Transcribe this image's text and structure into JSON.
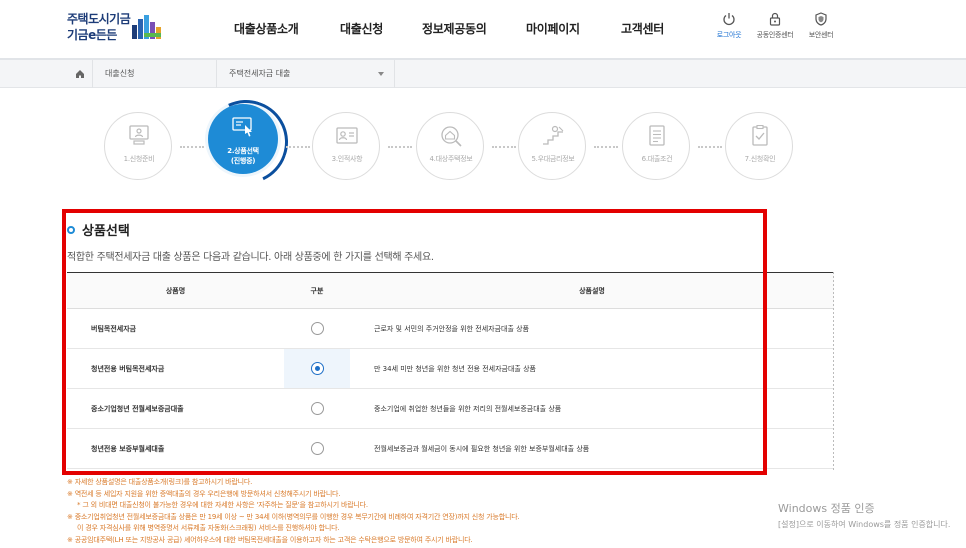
{
  "logo": {
    "line1": "주택도시기금",
    "line2": "기금e든든"
  },
  "nav": [
    "대출상품소개",
    "대출신청",
    "정보제공동의",
    "마이페이지",
    "고객센터"
  ],
  "utility": [
    {
      "label": "로그아웃",
      "icon": "power-icon",
      "active": true
    },
    {
      "label": "공동인증센터",
      "icon": "lock-icon",
      "active": false
    },
    {
      "label": "보안센터",
      "icon": "shield-icon",
      "active": false
    }
  ],
  "breadcrumb": {
    "home_icon": "home-icon",
    "level1": "대출신청",
    "level2": "주택전세자금 대출"
  },
  "steps": [
    {
      "label": "1.신청준비"
    },
    {
      "label_line1": "2.상품선택",
      "label_line2": "(진행중)"
    },
    {
      "label": "3.인적사항"
    },
    {
      "label": "4.대상주택정보"
    },
    {
      "label": "5.우대금리정보"
    },
    {
      "label": "6.대출조건"
    },
    {
      "label": "7.신청확인"
    }
  ],
  "section": {
    "title": "상품선택",
    "description": "적합한 주택전세자금 대출 상품은 다음과 같습니다. 아래 상품중에 한 가지를 선택해 주세요."
  },
  "table": {
    "headers": [
      "상품명",
      "구분",
      "상품설명"
    ],
    "rows": [
      {
        "name": "버팀목전세자금",
        "desc": "근로자 및 서민의 주거안정을 위한 전세자금대출 상품",
        "selected": false
      },
      {
        "name": "청년전용 버팀목전세자금",
        "desc": "만 34세 미만 청년을 위한 청년 전용 전세자금대출 상품",
        "selected": true
      },
      {
        "name": "중소기업청년 전월세보증금대출",
        "desc": "중소기업에 취업한 청년들을 위한 저리의 전월세보증금대출 상품",
        "selected": false
      },
      {
        "name": "청년전용 보증부월세대출",
        "desc": "전월세보증금과 월세금이 동시에 필요한 청년을 위한 보증부월세대출 상품",
        "selected": false
      }
    ]
  },
  "notes": [
    "※ 자세한 상품설명은 대출상품소개(링크)를 참고하시기 바랍니다.",
    "※ 역전세 등 세입자 지원을 위한 증액대출의 경우 우리은행에 방문하셔서 신청해주시기 바랍니다.",
    "* 그 외 비대면 대출신청이 불가능한 경우에 대한 자세한 사항은 '자주하는 질문'을 참고하시기 바랍니다.",
    "※ 중소기업취업청년 전월세보증금대출 상품은 만 19세 이상 ~ 만 34세 이하(병역의무를 이행한 경우 복무기간에 비례하여 자격기간 연장)까지 신청 가능합니다.",
    "이 경우 자격심사를 위해 병역증명서 서류제출 자동화(스크래핑) 서비스를 진행하셔야 합니다.",
    "※ 공공임대주택(LH 또는 지방공사 공급) 셰어하우스에 대한 버팀목전세대출을 이용하고자 하는 고객은 수탁은행으로 방문하여 주시기 바랍니다."
  ],
  "watermark": {
    "line1": "Windows 정품 인증",
    "line2": "[설정]으로 이동하여 Windows를 정품 인증합니다."
  },
  "colors": {
    "accent": "#1e8bd6",
    "highlight_box": "#e30000",
    "note_text": "#d97a2a"
  }
}
